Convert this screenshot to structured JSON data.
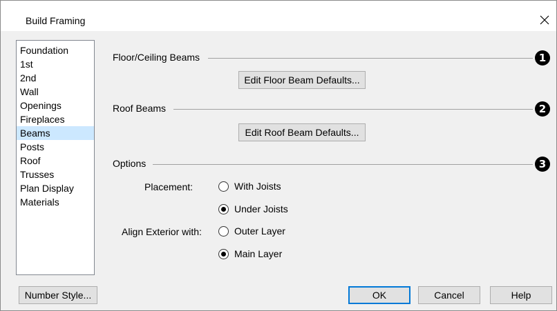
{
  "window": {
    "title": "Build Framing",
    "close_icon": "close-icon"
  },
  "sidebar": {
    "items": [
      {
        "label": "Foundation",
        "selected": false
      },
      {
        "label": "1st",
        "selected": false
      },
      {
        "label": "2nd",
        "selected": false
      },
      {
        "label": "Wall",
        "selected": false
      },
      {
        "label": "Openings",
        "selected": false
      },
      {
        "label": "Fireplaces",
        "selected": false
      },
      {
        "label": "Beams",
        "selected": true
      },
      {
        "label": "Posts",
        "selected": false
      },
      {
        "label": "Roof",
        "selected": false
      },
      {
        "label": "Trusses",
        "selected": false
      },
      {
        "label": "Plan Display",
        "selected": false
      },
      {
        "label": "Materials",
        "selected": false
      }
    ]
  },
  "floor_ceiling": {
    "label": "Floor/Ceiling Beams",
    "callout": "1",
    "button": "Edit Floor Beam Defaults..."
  },
  "roof": {
    "label": "Roof Beams",
    "callout": "2",
    "button": "Edit Roof Beam Defaults..."
  },
  "options": {
    "label": "Options",
    "callout": "3",
    "placement_label": "Placement:",
    "placement_options": [
      {
        "label": "With Joists",
        "checked": false
      },
      {
        "label": "Under Joists",
        "checked": true
      }
    ],
    "align_label": "Align Exterior with:",
    "align_options": [
      {
        "label": "Outer Layer",
        "checked": false
      },
      {
        "label": "Main Layer",
        "checked": true
      }
    ]
  },
  "footer": {
    "number_style": "Number Style...",
    "ok": "OK",
    "cancel": "Cancel",
    "help": "Help"
  },
  "colors": {
    "selected_item": "#cce8ff",
    "default_button_border": "#0078d7"
  }
}
